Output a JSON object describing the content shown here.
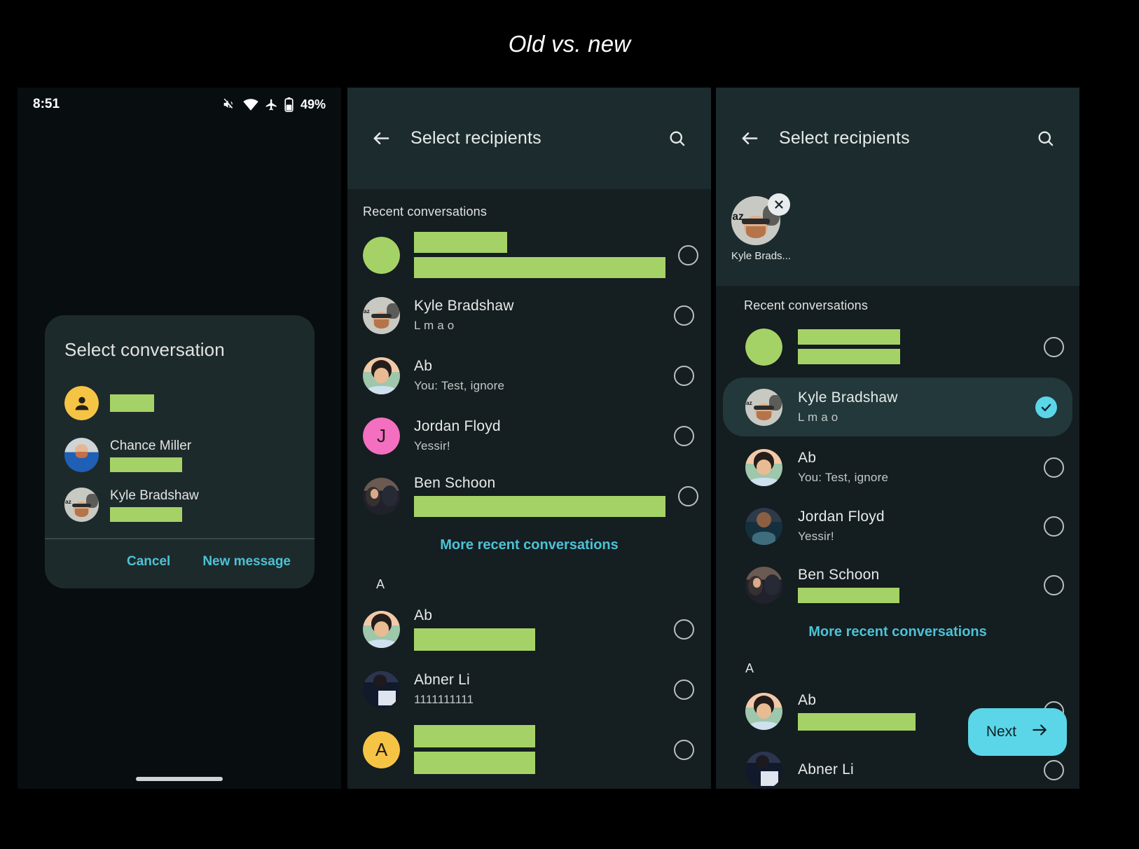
{
  "title": "Old vs. new",
  "colors": {
    "accent_cyan": "#4cc2d6",
    "fab_cyan": "#5bd6e8",
    "redaction_green": "#a5d267",
    "avatar_yellow": "#f6c445",
    "avatar_pink": "#f46fc0",
    "panel_bg": "#151e20",
    "appbar_bg": "#1c2c2e",
    "selected_row_bg": "#22383a"
  },
  "old_phone": {
    "status_bar": {
      "time": "8:51",
      "battery_percent": "49%",
      "icons": [
        "mute-icon",
        "wifi-icon",
        "airplane-mode-icon",
        "battery-icon"
      ]
    },
    "dialog": {
      "title": "Select conversation",
      "rows": [
        {
          "name": "",
          "redacted_name": true,
          "avatar": "person-placeholder",
          "subtitle": ""
        },
        {
          "name": "Chance Miller",
          "redacted_name": false,
          "avatar": "photo-chance",
          "subtitle": ""
        },
        {
          "name": "Kyle Bradshaw",
          "redacted_name": false,
          "avatar": "photo-kyle",
          "subtitle": ""
        }
      ],
      "cancel_label": "Cancel",
      "new_message_label": "New message"
    }
  },
  "mid_phone": {
    "appbar": {
      "title": "Select recipients",
      "back_icon": "arrow-back-icon",
      "search_icon": "search-icon"
    },
    "section_label": "Recent conversations",
    "recent": [
      {
        "name": "",
        "subtitle": "",
        "redacted": true,
        "avatar": "solid-green"
      },
      {
        "name": "Kyle Bradshaw",
        "subtitle": "L m a o",
        "redacted": false,
        "avatar": "photo-kyle"
      },
      {
        "name": "Ab",
        "subtitle": "You: Test, ignore",
        "redacted": false,
        "avatar": "photo-ab"
      },
      {
        "name": "Jordan Floyd",
        "subtitle": "Yessir!",
        "redacted": false,
        "avatar": "initial-J"
      },
      {
        "name": "Ben Schoon",
        "subtitle": "",
        "redacted": false,
        "subtitle_redacted": true,
        "avatar": "photo-ben"
      }
    ],
    "more_link": "More recent conversations",
    "alpha_header": "A",
    "contacts": [
      {
        "name": "Ab",
        "subtitle": "",
        "subtitle_redacted": true,
        "avatar": "photo-ab"
      },
      {
        "name": "Abner Li",
        "subtitle": "1111111111",
        "avatar": "photo-abner"
      },
      {
        "name": "",
        "subtitle": "",
        "redacted": true,
        "avatar": "initial-A"
      }
    ]
  },
  "new_phone": {
    "appbar": {
      "title": "Select recipients",
      "back_icon": "arrow-back-icon",
      "search_icon": "search-icon"
    },
    "chip": {
      "label": "Kyle Brads...",
      "remove_icon": "close-icon",
      "avatar": "photo-kyle"
    },
    "section_label": "Recent conversations",
    "recent": [
      {
        "name": "",
        "subtitle": "",
        "redacted": true,
        "avatar": "solid-green",
        "selected": false
      },
      {
        "name": "Kyle Bradshaw",
        "subtitle": "L m a o",
        "redacted": false,
        "avatar": "photo-kyle",
        "selected": true
      },
      {
        "name": "Ab",
        "subtitle": "You: Test, ignore",
        "redacted": false,
        "avatar": "photo-ab",
        "selected": false
      },
      {
        "name": "Jordan Floyd",
        "subtitle": "Yessir!",
        "redacted": false,
        "avatar": "photo-jordan",
        "selected": false
      },
      {
        "name": "Ben Schoon",
        "subtitle": "",
        "subtitle_redacted": true,
        "avatar": "photo-ben",
        "selected": false
      }
    ],
    "more_link": "More recent conversations",
    "alpha_header": "A",
    "contacts": [
      {
        "name": "Ab",
        "subtitle": "",
        "subtitle_redacted": true,
        "avatar": "photo-ab"
      },
      {
        "name": "Abner Li",
        "subtitle": "",
        "avatar": "photo-abner"
      }
    ],
    "fab": {
      "label": "Next",
      "icon": "arrow-forward-icon"
    }
  }
}
